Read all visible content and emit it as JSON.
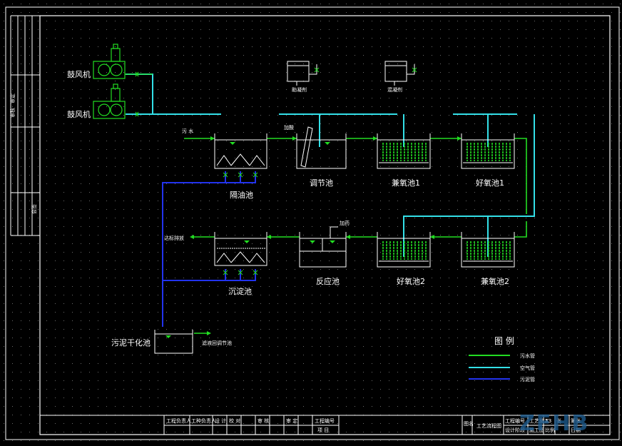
{
  "colors": {
    "background": "#000000",
    "sewage_pipe": "#22dd22",
    "air_pipe": "#33e0e8",
    "sludge_pipe": "#2233ee",
    "equipment": "#22dd22",
    "frame": "#ffffff"
  },
  "equipment": {
    "blower_1": "鼓风机",
    "blower_2": "鼓风机",
    "agent_tank_1": "助凝剂",
    "agent_tank_2": "混凝剂"
  },
  "flow_labels": {
    "sewage_in": "污  水",
    "acid_add": "加酸",
    "acid_add_2": "加药",
    "discharge": "达标排放",
    "sludge_out": "滤液回调节池"
  },
  "tanks": {
    "grease_trap": "隔油池",
    "equalization": "调节池",
    "anoxic_1": "兼氧池1",
    "aerobic_1": "好氧池1",
    "settling": "沉淀池",
    "reaction": "反应池",
    "aerobic_2": "好氧池2",
    "anoxic_2": "兼氧池2",
    "sludge_dry": "污泥干化池"
  },
  "legend": {
    "title": "图  例",
    "items": [
      {
        "label": "污水管",
        "color": "#22dd22"
      },
      {
        "label": "空气管",
        "color": "#33e0e8"
      },
      {
        "label": "污泥管",
        "color": "#2233ee"
      }
    ]
  },
  "side_block": {
    "label_a": "审定",
    "label_b": "审核",
    "label_c": "会签"
  },
  "title_block": {
    "c1": "工程负责人",
    "c2": "工种负责人",
    "c3": "设  计",
    "c4": "校  对",
    "c5": "审  核",
    "c6": "审  定",
    "c7": "工程编号",
    "c8": "项  目",
    "drawing_label": "图名",
    "drawing_title": "工艺流程图",
    "r1": "工程编号",
    "r2": "设计阶段",
    "r3": "施工图",
    "r4": "工艺施工",
    "r5": "比例",
    "r6": "日期",
    "r7": "A3",
    "r8": "张",
    "r9": "第张"
  },
  "watermark": "ZFHB"
}
